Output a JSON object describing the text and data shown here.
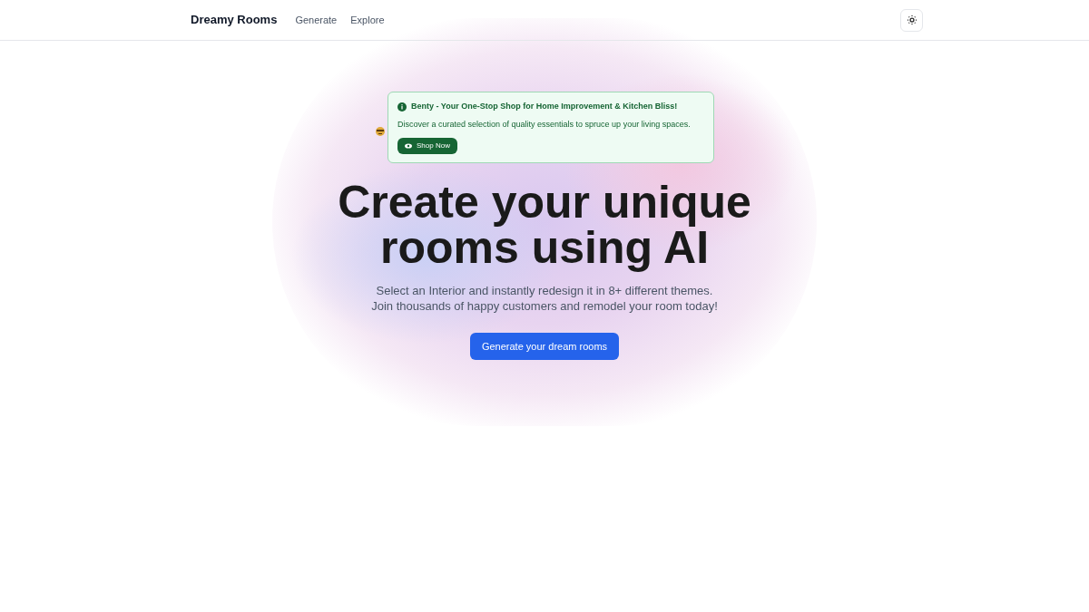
{
  "nav": {
    "brand": "Dreamy Rooms",
    "links": [
      "Generate",
      "Explore"
    ]
  },
  "banner": {
    "title": "Benty - Your One-Stop Shop for Home Improvement & Kitchen Bliss!",
    "text": "Discover a curated selection of quality essentials to spruce up your living spaces.",
    "button": "Shop Now"
  },
  "hero": {
    "heading_lines": [
      "Create your unique",
      "rooms using AI"
    ],
    "subtitle_lines": [
      "Select an Interior and instantly redesign it in 8+ different themes.",
      "Join thousands of happy customers and remodel your room today!"
    ],
    "cta": "Generate your dream rooms"
  }
}
